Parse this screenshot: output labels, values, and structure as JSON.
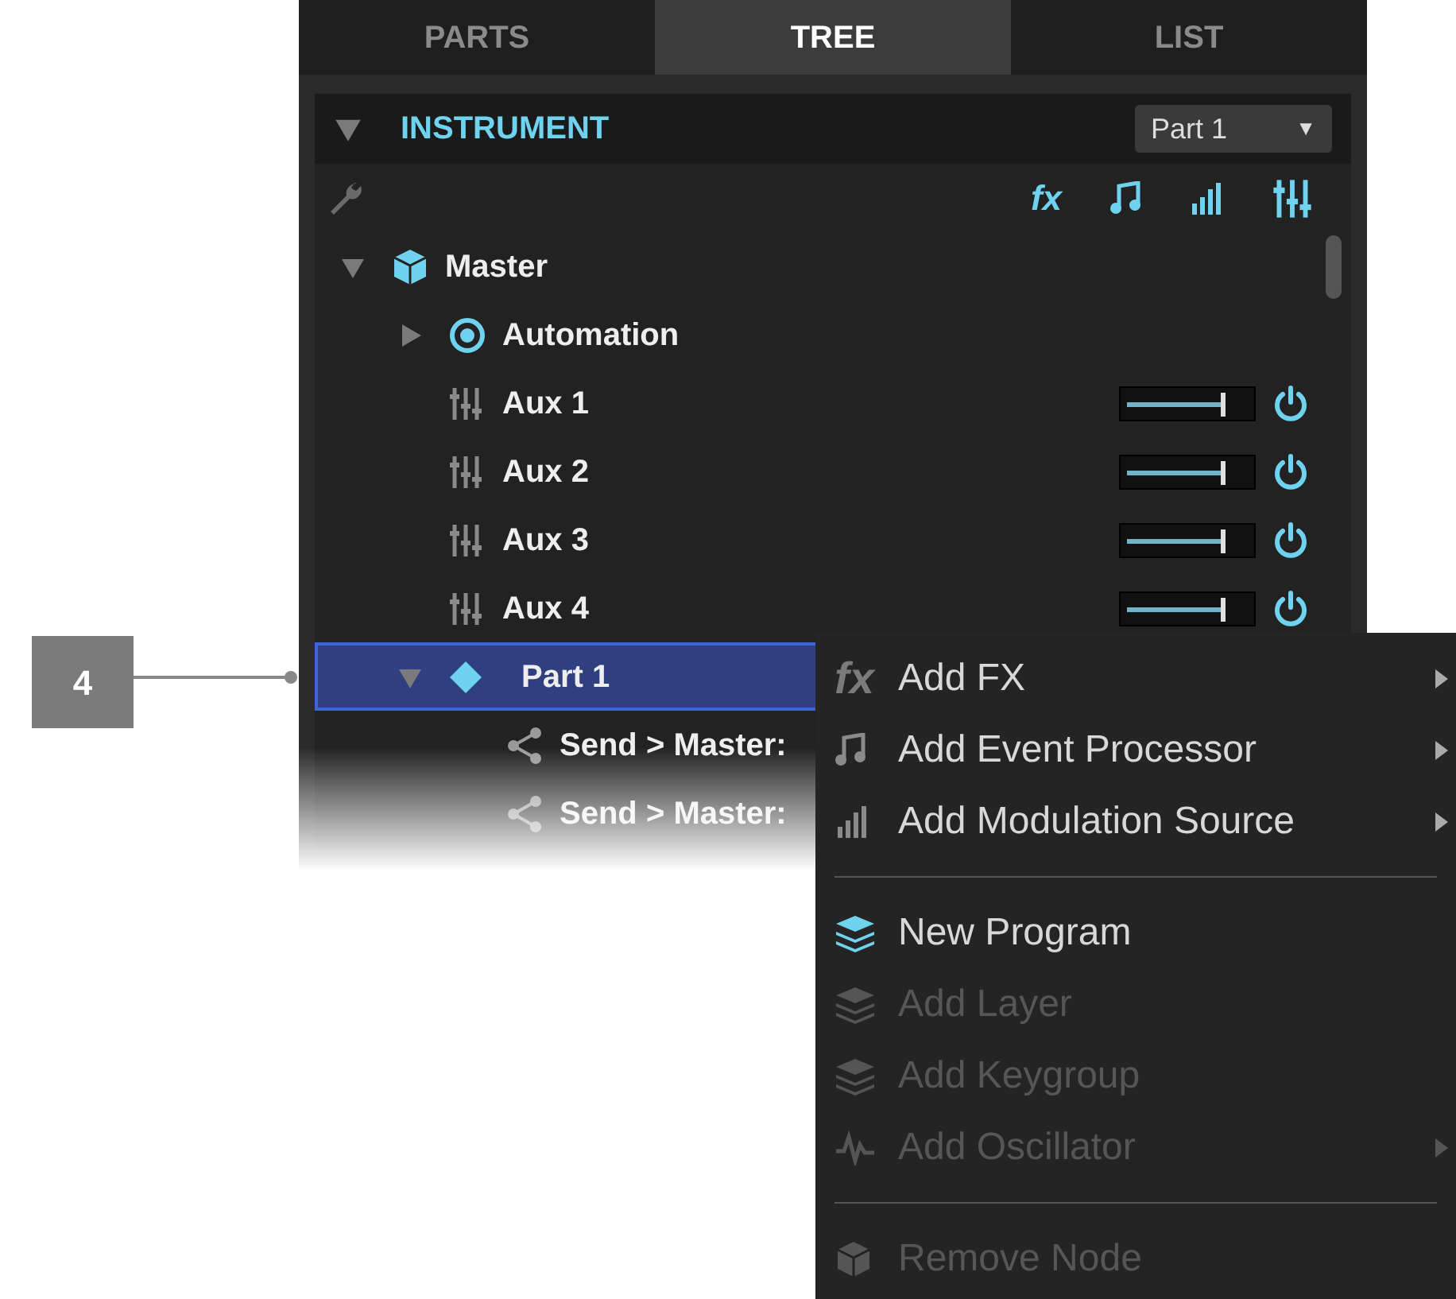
{
  "tabs": [
    {
      "label": "PARTS",
      "selected": false
    },
    {
      "label": "TREE",
      "selected": true
    },
    {
      "label": "LIST",
      "selected": false
    }
  ],
  "header": {
    "title": "INSTRUMENT",
    "expanded": true,
    "dropdown": {
      "value": "Part 1",
      "caret": "▼"
    }
  },
  "toolbar": [
    {
      "kind": "fx",
      "glyph": "fx"
    },
    {
      "kind": "note"
    },
    {
      "kind": "bars"
    },
    {
      "kind": "mixer"
    }
  ],
  "tree": [
    {
      "kind": "master",
      "label": "Master",
      "expanded": true,
      "children": [
        {
          "kind": "automation",
          "label": "Automation",
          "expanded": false
        },
        {
          "kind": "aux",
          "label": "Aux 1",
          "level": 0.8,
          "on": true
        },
        {
          "kind": "aux",
          "label": "Aux 2",
          "level": 0.8,
          "on": true
        },
        {
          "kind": "aux",
          "label": "Aux 3",
          "level": 0.8,
          "on": true
        },
        {
          "kind": "aux",
          "label": "Aux 4",
          "level": 0.8,
          "on": true
        },
        {
          "kind": "part",
          "label": "Part 1",
          "expanded": true,
          "selected": true,
          "children": [
            {
              "kind": "send",
              "label": "Send > Master:"
            },
            {
              "kind": "send",
              "label": "Send > Master:"
            }
          ]
        }
      ]
    }
  ],
  "menu": [
    {
      "kind": "fx",
      "glyph": "fx",
      "label": "Add FX",
      "disabled": false,
      "submenu": true
    },
    {
      "kind": "note",
      "label": "Add Event Processor",
      "disabled": false,
      "submenu": true
    },
    {
      "kind": "bars",
      "label": "Add Modulation Source",
      "disabled": false,
      "submenu": true
    },
    {
      "kind": "separator"
    },
    {
      "kind": "layers",
      "label": "New Program",
      "disabled": false,
      "submenu": false
    },
    {
      "kind": "layers",
      "label": "Add Layer",
      "disabled": true,
      "submenu": false
    },
    {
      "kind": "layers",
      "label": "Add Keygroup",
      "disabled": true,
      "submenu": false
    },
    {
      "kind": "wave",
      "label": "Add Oscillator",
      "disabled": true,
      "submenu": true
    },
    {
      "kind": "separator"
    },
    {
      "kind": "cube",
      "label": "Remove Node",
      "disabled": true,
      "submenu": false
    }
  ],
  "callout": {
    "label": "4"
  }
}
